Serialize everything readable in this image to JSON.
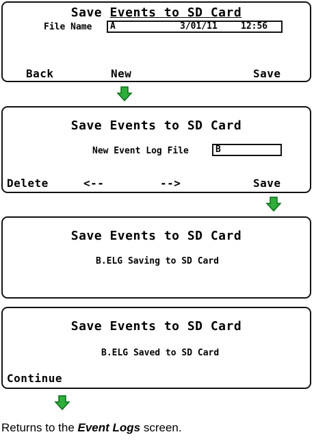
{
  "colors": {
    "arrow": "#2fae3a",
    "arrow_outline": "#0b6e1b",
    "border": "#111111"
  },
  "screens": [
    {
      "title_prefix": "Save ",
      "title_emph": "Events to SD Card",
      "file_name_label": "File Name",
      "file_name_value": "A",
      "date": "3/01/11",
      "time": "12:56",
      "softkeys": [
        "Back",
        "New",
        "Save"
      ]
    },
    {
      "title": "Save Events to SD Card",
      "field_label": "New Event Log File",
      "field_value": "B",
      "softkeys": [
        "Delete",
        "<--",
        "-->",
        "Save"
      ]
    },
    {
      "title": "Save Events to SD Card",
      "message": "B.ELG Saving to SD Card"
    },
    {
      "title": "Save Events to SD Card",
      "message": "B.ELG Saved to SD Card",
      "softkeys": [
        "Continue"
      ]
    }
  ],
  "footer": {
    "prefix": "Returns to the ",
    "emph": "Event Logs",
    "suffix": " screen."
  },
  "icons": [
    "down-arrow-icon"
  ]
}
